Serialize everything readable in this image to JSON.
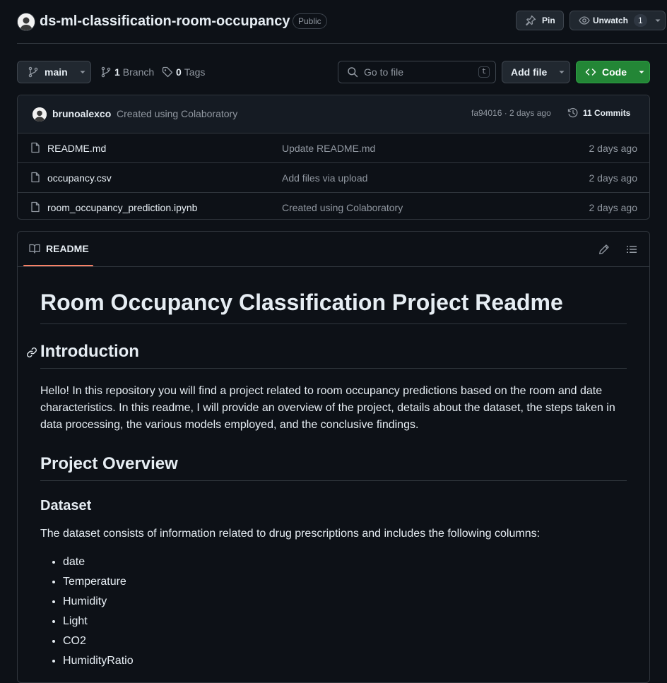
{
  "header": {
    "repo_name": "ds-ml-classification-room-occupancy",
    "visibility": "Public",
    "pin_label": "Pin",
    "watch_label": "Unwatch",
    "watch_count": "1"
  },
  "toolbar": {
    "branch": "main",
    "branch_count": "1",
    "branch_label": "Branch",
    "tag_count": "0",
    "tag_label": "Tags",
    "search_placeholder": "Go to file",
    "search_shortcut": "t",
    "add_file_label": "Add file",
    "code_label": "Code"
  },
  "latest_commit": {
    "user": "brunoalexco",
    "message": "Created using Colaboratory",
    "hash_time": "fa94016 · 2 days ago",
    "commits_label": "11 Commits"
  },
  "files": [
    {
      "name": "README.md",
      "message": "Update README.md",
      "date": "2 days ago"
    },
    {
      "name": "occupancy.csv",
      "message": "Add files via upload",
      "date": "2 days ago"
    },
    {
      "name": "room_occupancy_prediction.ipynb",
      "message": "Created using Colaboratory",
      "date": "2 days ago"
    }
  ],
  "readme": {
    "tab_label": "README",
    "title": "Room Occupancy Classification Project Readme",
    "intro_heading": "Introduction",
    "intro_text": "Hello! In this repository you will find a project related to room occupancy predictions based on the room and date characteristics. In this readme, I will provide an overview of the project, details about the dataset, the steps taken in data processing, the various models employed, and the conclusive findings.",
    "overview_heading": "Project Overview",
    "dataset_heading": "Dataset",
    "dataset_text": "The dataset consists of information related to drug prescriptions and includes the following columns:",
    "columns": [
      "date",
      "Temperature",
      "Humidity",
      "Light",
      "CO2",
      "HumidityRatio"
    ]
  },
  "colors": {
    "background": "#0d1117",
    "code_button": "#238636",
    "tab_underline": "#f78166"
  }
}
